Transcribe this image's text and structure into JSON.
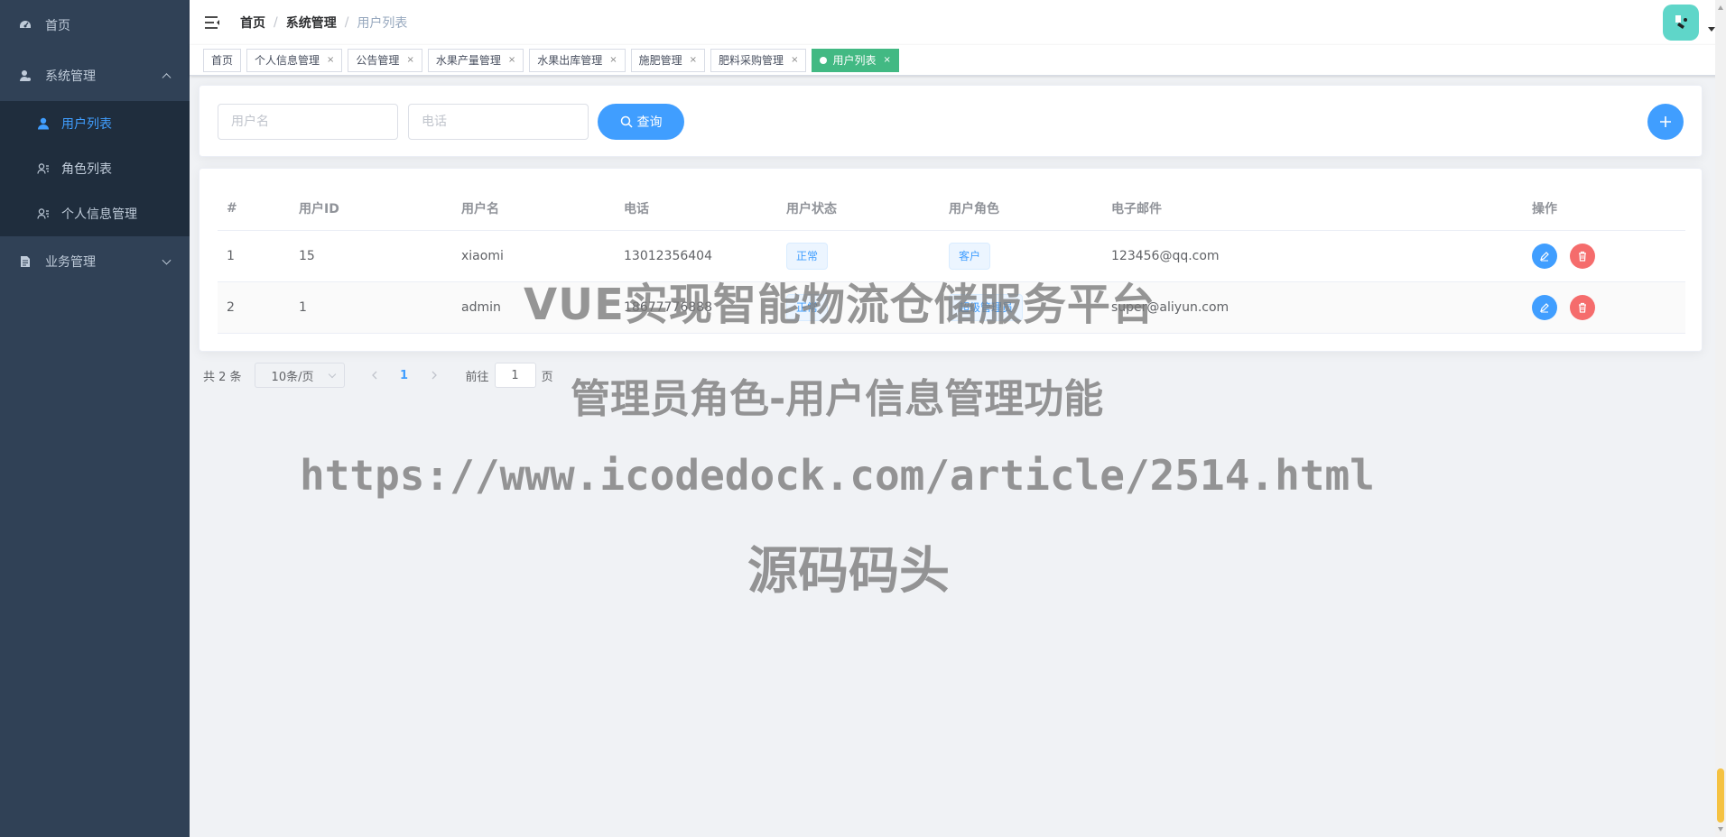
{
  "sidebar": {
    "items": [
      {
        "label": "首页",
        "icon": "dashboard-icon"
      },
      {
        "label": "系统管理",
        "icon": "user-admin-icon",
        "expanded": true,
        "children": [
          {
            "label": "用户列表",
            "icon": "user-icon",
            "active": true
          },
          {
            "label": "角色列表",
            "icon": "role-icon"
          },
          {
            "label": "个人信息管理",
            "icon": "role-icon"
          }
        ]
      },
      {
        "label": "业务管理",
        "icon": "document-icon",
        "expanded": false
      }
    ]
  },
  "navbar": {
    "breadcrumb": [
      "首页",
      "系统管理",
      "用户列表"
    ],
    "separator": "/"
  },
  "tags": [
    {
      "label": "首页",
      "closable": false
    },
    {
      "label": "个人信息管理",
      "closable": true
    },
    {
      "label": "公告管理",
      "closable": true
    },
    {
      "label": "水果产量管理",
      "closable": true
    },
    {
      "label": "水果出库管理",
      "closable": true
    },
    {
      "label": "施肥管理",
      "closable": true
    },
    {
      "label": "肥料采购管理",
      "closable": true
    },
    {
      "label": "用户列表",
      "closable": true,
      "active": true
    }
  ],
  "tag_close_glyph": "×",
  "search": {
    "username_placeholder": "用户名",
    "phone_placeholder": "电话",
    "search_label": "查询"
  },
  "table": {
    "headers": [
      "#",
      "用户ID",
      "用户名",
      "电话",
      "用户状态",
      "用户角色",
      "电子邮件",
      "操作"
    ],
    "rows": [
      {
        "index": "1",
        "id": "15",
        "username": "xiaomi",
        "phone": "13012356404",
        "status": "正常",
        "role": "客户",
        "email": "123456@qq.com"
      },
      {
        "index": "2",
        "id": "1",
        "username": "admin",
        "phone": "18677776888",
        "status": "正常",
        "role": "超级管理员",
        "email": "super@aliyun.com"
      }
    ]
  },
  "pagination": {
    "total": "共 2 条",
    "page_size": "10条/页",
    "current": "1",
    "goto_prefix": "前往",
    "goto_value": "1",
    "goto_suffix": "页"
  },
  "watermark": {
    "line1": "VUE实现智能物流仓储服务平台",
    "line2": "管理员角色-用户信息管理功能",
    "line3": "https://www.icodedock.com/article/2514.html",
    "line4": "源码码头"
  },
  "colors": {
    "sidebar_bg": "#304156",
    "submenu_bg": "#1f2d3d",
    "primary": "#409eff",
    "active_tag": "#42b983",
    "danger": "#f56c6c",
    "avatar_bg": "#5fd6c9"
  }
}
